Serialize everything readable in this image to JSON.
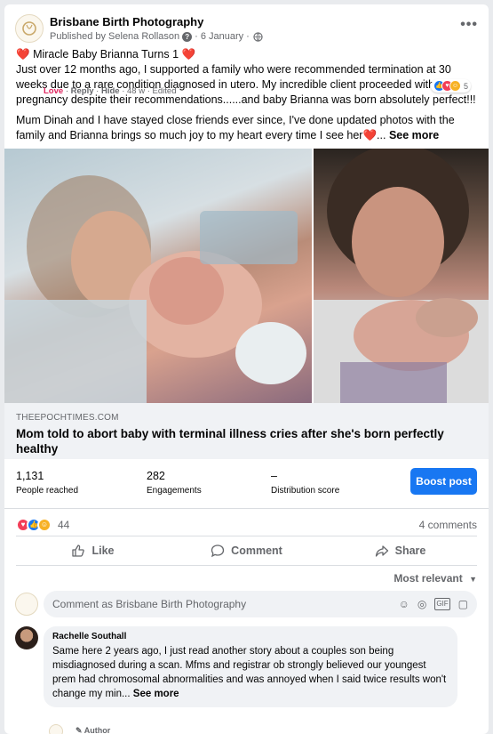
{
  "post": {
    "page_name": "Brisbane Birth Photography",
    "published_by": "Published by Selena Rollason",
    "date": "6 January",
    "more_icon": "more-horizontal-icon",
    "text_line1": "Miracle Baby Brianna Turns 1",
    "text_para1": "Just over 12 months ago, I supported a family who were recommended termination at 30 weeks due to a rare condition diagnosed in utero. My incredible client proceeded with her pregnancy despite their recommendations......and baby Brianna was born absolutely perfect!!!",
    "text_para2": "Mum Dinah and I have stayed close friends ever since, I've done updated photos with the family and Brianna brings so much joy to my heart every time I see her",
    "see_more": "See more"
  },
  "link": {
    "domain": "THEEPOCHTIMES.COM",
    "title": "Mom told to abort baby with terminal illness cries after she's born perfectly healthy"
  },
  "insights": {
    "people_reached": {
      "value": "1,131",
      "label": "People reached"
    },
    "engagements": {
      "value": "282",
      "label": "Engagements"
    },
    "distribution": {
      "value": "–",
      "label": "Distribution score"
    },
    "boost_label": "Boost post"
  },
  "reactions": {
    "count": "44",
    "comments": "4 comments"
  },
  "actions": {
    "like": "Like",
    "comment": "Comment",
    "share": "Share"
  },
  "comments_section": {
    "sort": "Most relevant",
    "input_placeholder": "Comment as Brisbane Birth Photography",
    "comment": {
      "author": "Rachelle Southall",
      "text": "Same here 2 years ago, I just read another story about a couples son being misdiagnosed during a scan. Mfms and registrar ob strongly believed our youngest prem had chromosomal abnormalities and was annoyed when I said twice results won't change my min...",
      "see_more": "See more",
      "love": "Love",
      "reply": "Reply",
      "hide": "Hide",
      "time": "48 w",
      "edited": "Edited",
      "react_count": "5"
    },
    "reply_author": "Author"
  },
  "colors": {
    "accent": "#1877f2",
    "love": "#f33e58",
    "care": "#f7b125"
  }
}
